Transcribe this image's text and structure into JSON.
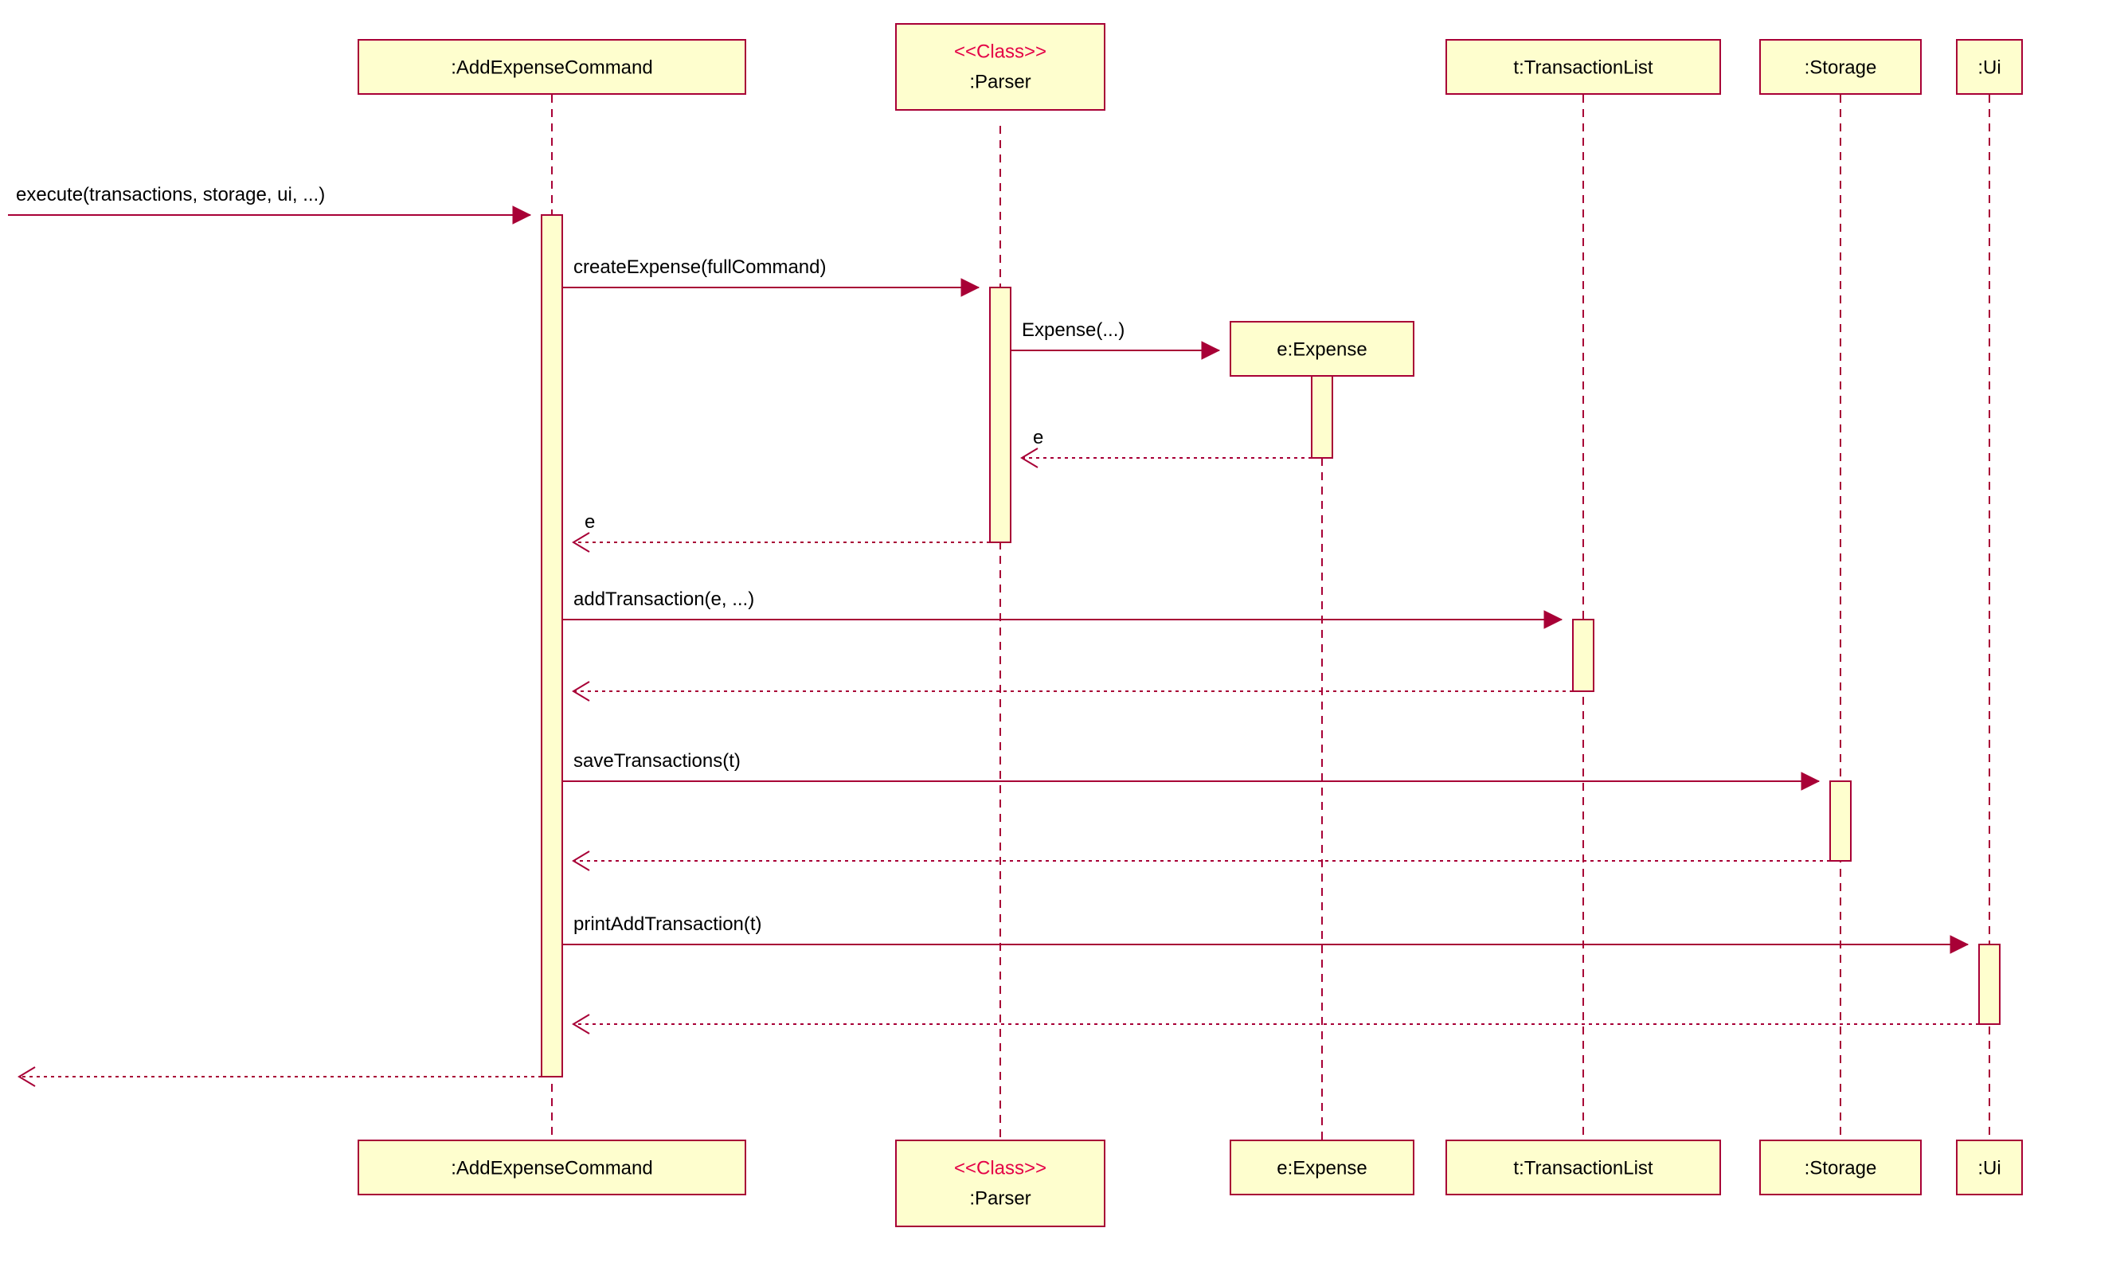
{
  "participants": {
    "addExpenseCommand": ":AddExpenseCommand",
    "parser_stereo": "<<Class>>",
    "parser_name": ":Parser",
    "expense": "e:Expense",
    "transactionList": "t:TransactionList",
    "storage": ":Storage",
    "ui": ":Ui"
  },
  "messages": {
    "m1": "execute(transactions, storage, ui, ...)",
    "m2": "createExpense(fullCommand)",
    "m3": "Expense(...)",
    "m4": "e",
    "m5": "e",
    "m6": "addTransaction(e, ...)",
    "m7": "saveTransactions(t)",
    "m8": "printAddTransaction(t)"
  }
}
